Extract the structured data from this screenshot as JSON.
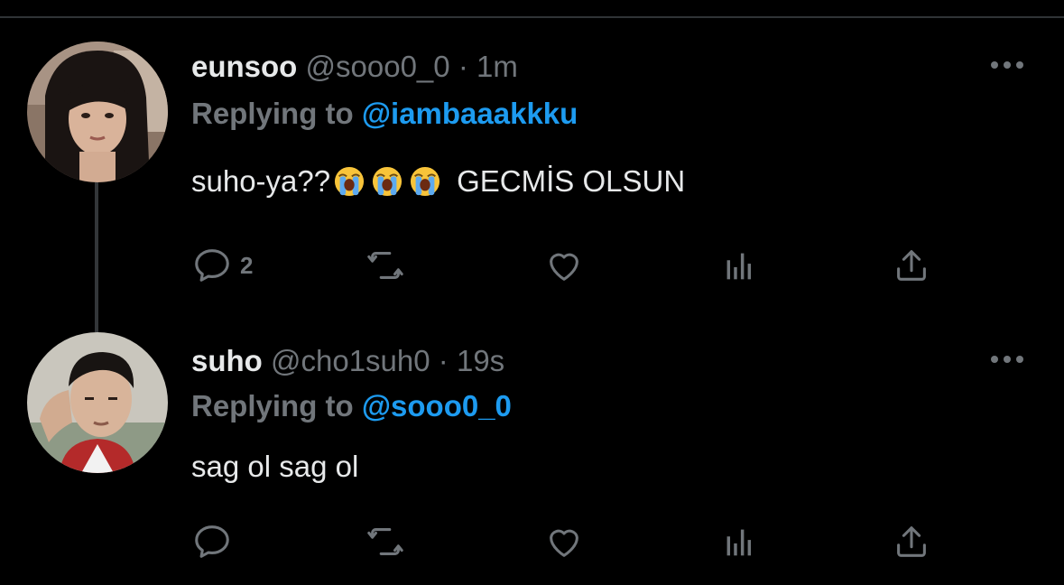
{
  "tweets": [
    {
      "display_name": "eunsoo",
      "handle": "@sooo0_0",
      "separator": "·",
      "time": "1m",
      "replying_label": "Replying to",
      "reply_to": "@iambaaakkku",
      "text_before": "suho-ya??",
      "emojis": [
        "loudly-crying-face",
        "loudly-crying-face",
        "loudly-crying-face"
      ],
      "text_after": "GECMİS OLSUN",
      "actions": {
        "reply_count": "2",
        "retweet_count": "",
        "like_count": ""
      }
    },
    {
      "display_name": "suho",
      "handle": "@cho1suh0",
      "separator": "·",
      "time": "19s",
      "replying_label": "Replying to",
      "reply_to": "@sooo0_0",
      "text": "sag ol sag ol",
      "actions": {
        "reply_count": "",
        "retweet_count": "",
        "like_count": ""
      }
    }
  ],
  "icons": {
    "more": "more-horizontal-icon",
    "reply": "reply-icon",
    "retweet": "retweet-icon",
    "like": "heart-icon",
    "views": "analytics-icon",
    "share": "share-icon"
  },
  "colors": {
    "background": "#000000",
    "text": "#e7e9ea",
    "secondary": "#71767b",
    "accent": "#1d9bf0",
    "thread_line": "#333639"
  }
}
